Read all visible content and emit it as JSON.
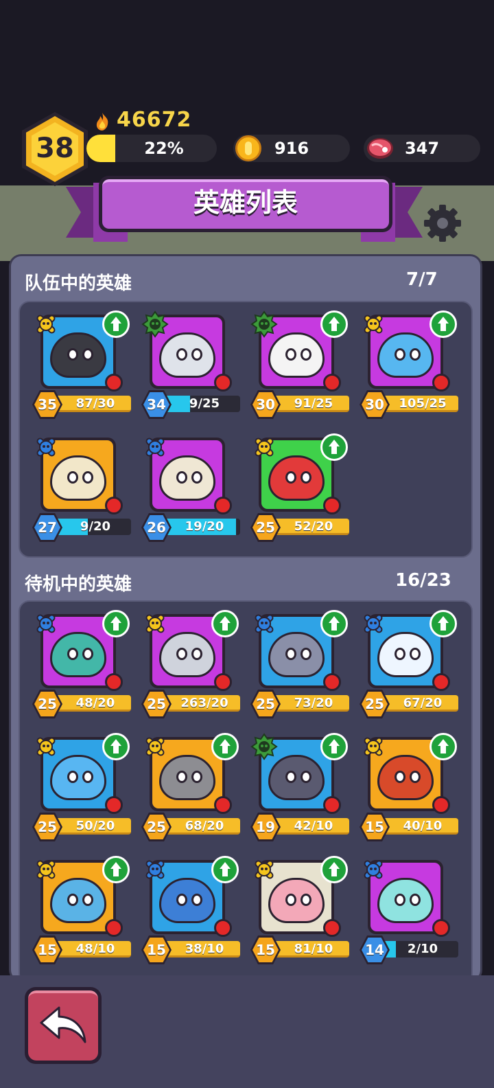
{
  "player": {
    "level": "38",
    "power": "46672",
    "xp_percent_label": "22%",
    "xp_fraction": 0.22
  },
  "resources": {
    "coins": "916",
    "meat": "347"
  },
  "title": "英雄列表",
  "team": {
    "label": "队伍中的英雄",
    "count": "7/7",
    "heroes": [
      {
        "level": "35",
        "progress": "87/30",
        "full": true,
        "fill": 1,
        "tier": "gold",
        "bg": "#2fa3e6",
        "face": "#3a3a42",
        "upgrade": true
      },
      {
        "level": "34",
        "progress": "9/25",
        "full": false,
        "fill": 0.36,
        "tier": "green",
        "bg": "#c63ae0",
        "face": "#dfe3ea",
        "upgrade": false
      },
      {
        "level": "30",
        "progress": "91/25",
        "full": true,
        "fill": 1,
        "tier": "green",
        "bg": "#c63ae0",
        "face": "#f4f4f4",
        "upgrade": true
      },
      {
        "level": "30",
        "progress": "105/25",
        "full": true,
        "fill": 1,
        "tier": "gold",
        "bg": "#c63ae0",
        "face": "#57b7f0",
        "upgrade": true
      },
      {
        "level": "27",
        "progress": "9/20",
        "full": false,
        "fill": 0.45,
        "tier": "blue",
        "bg": "#f6a81e",
        "face": "#f2e7c9",
        "upgrade": false
      },
      {
        "level": "26",
        "progress": "19/20",
        "full": false,
        "fill": 0.95,
        "tier": "blue",
        "bg": "#c63ae0",
        "face": "#efe7d4",
        "upgrade": false
      },
      {
        "level": "25",
        "progress": "52/20",
        "full": true,
        "fill": 1,
        "tier": "gold",
        "bg": "#3fd14a",
        "face": "#e23a3a",
        "upgrade": true
      }
    ]
  },
  "standby": {
    "label": "待机中的英雄",
    "count": "16/23",
    "heroes": [
      {
        "level": "25",
        "progress": "48/20",
        "full": true,
        "fill": 1,
        "tier": "blue",
        "bg": "#c63ae0",
        "face": "#43b7a8",
        "upgrade": true
      },
      {
        "level": "25",
        "progress": "263/20",
        "full": true,
        "fill": 1,
        "tier": "gold",
        "bg": "#c63ae0",
        "face": "#cfd3dc",
        "upgrade": true
      },
      {
        "level": "25",
        "progress": "73/20",
        "full": true,
        "fill": 1,
        "tier": "blue",
        "bg": "#2fa3e6",
        "face": "#8a8fa8",
        "upgrade": true
      },
      {
        "level": "25",
        "progress": "67/20",
        "full": true,
        "fill": 1,
        "tier": "blue",
        "bg": "#2fa3e6",
        "face": "#eef6ff",
        "upgrade": true
      },
      {
        "level": "25",
        "progress": "50/20",
        "full": true,
        "fill": 1,
        "tier": "gold",
        "bg": "#2fa3e6",
        "face": "#58b6f2",
        "upgrade": true
      },
      {
        "level": "25",
        "progress": "68/20",
        "full": true,
        "fill": 1,
        "tier": "gold",
        "bg": "#f6a81e",
        "face": "#8d8d92",
        "upgrade": true
      },
      {
        "level": "19",
        "progress": "42/10",
        "full": true,
        "fill": 1,
        "tier": "green",
        "bg": "#2fa3e6",
        "face": "#5a5a70",
        "upgrade": true
      },
      {
        "level": "15",
        "progress": "40/10",
        "full": true,
        "fill": 1,
        "tier": "gold",
        "bg": "#f6a81e",
        "face": "#d84a2a",
        "upgrade": true
      },
      {
        "level": "15",
        "progress": "48/10",
        "full": true,
        "fill": 1,
        "tier": "gold",
        "bg": "#f6a81e",
        "face": "#5ab3e6",
        "upgrade": true
      },
      {
        "level": "15",
        "progress": "38/10",
        "full": true,
        "fill": 1,
        "tier": "blue",
        "bg": "#2fa3e6",
        "face": "#3d7fd6",
        "upgrade": true
      },
      {
        "level": "15",
        "progress": "81/10",
        "full": true,
        "fill": 1,
        "tier": "gold",
        "bg": "#e7e2cf",
        "face": "#f3a8b8",
        "upgrade": true
      },
      {
        "level": "14",
        "progress": "2/10",
        "full": false,
        "fill": 0.2,
        "tier": "blue",
        "bg": "#c63ae0",
        "face": "#8fe3e0",
        "upgrade": false
      }
    ]
  },
  "colors": {
    "gold_tier": "#f5c51c",
    "green_tier": "#3c9b3a",
    "blue_tier": "#2f7fe0",
    "full_bar": "#f6bd28",
    "partial_bar": "#27c7ec"
  },
  "icons": {
    "power": "flame-icon",
    "coins": "coin-icon",
    "meat": "meat-icon",
    "settings": "gear-icon",
    "back": "back-arrow-icon",
    "upgrade": "upgrade-arrow-icon",
    "notification": "red-dot-icon"
  }
}
